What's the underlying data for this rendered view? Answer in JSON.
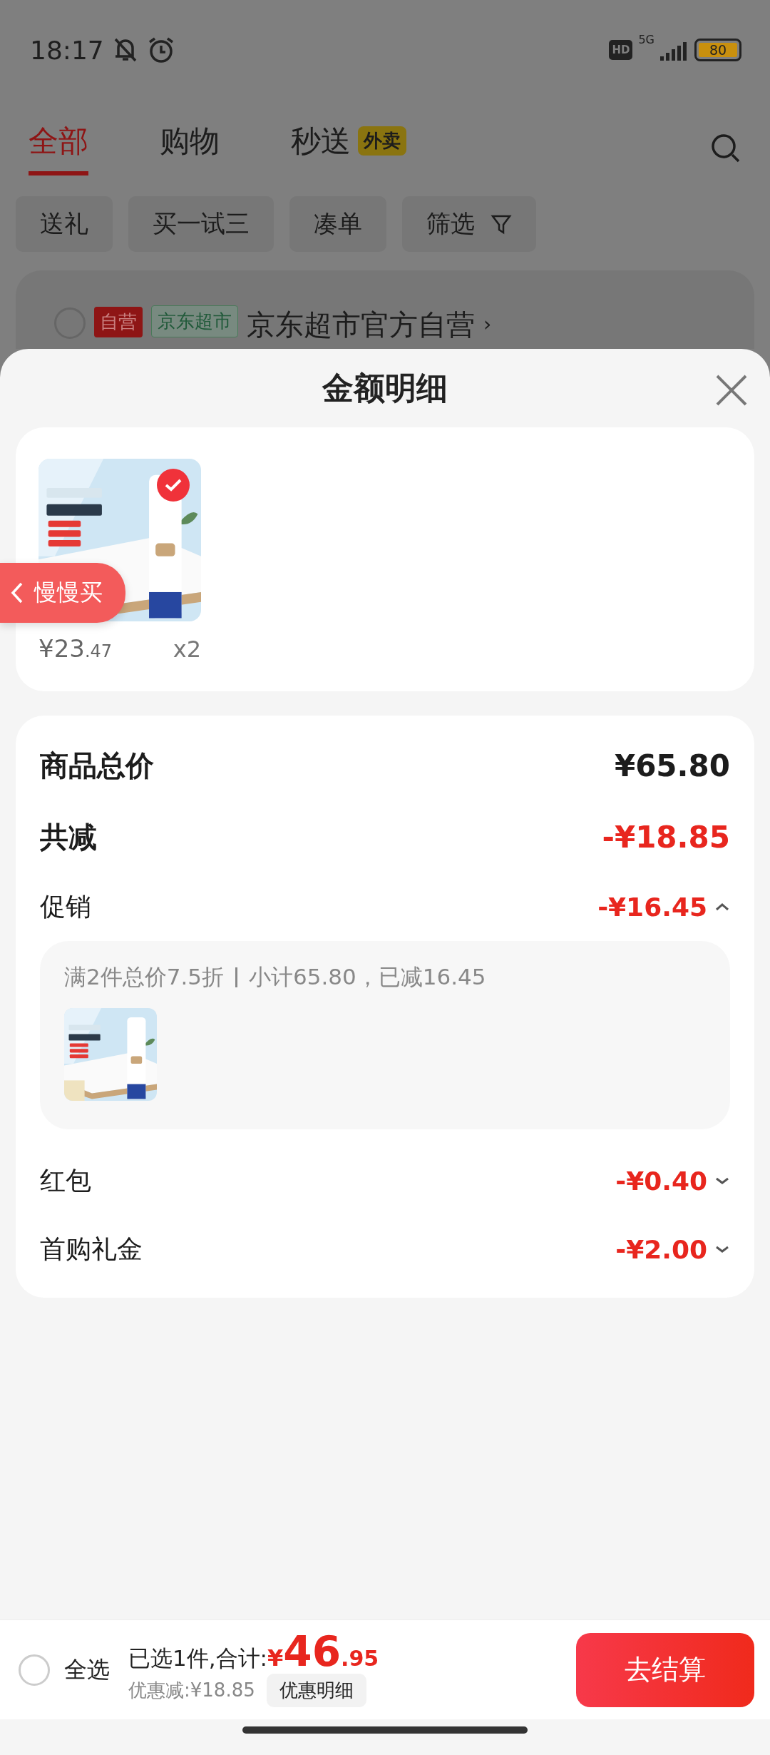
{
  "status_bar": {
    "time": "18:17",
    "hd": "HD",
    "network": "5G",
    "battery": "80"
  },
  "background": {
    "tabs": [
      {
        "label": "全部",
        "selected": true
      },
      {
        "label": "购物",
        "selected": false
      },
      {
        "label": "秒送",
        "selected": false,
        "badge": "外卖"
      }
    ],
    "chips": [
      {
        "label": "送礼",
        "kind": "plain"
      },
      {
        "label": "买一试三",
        "kind": "plain"
      },
      {
        "label": "凑单",
        "kind": "plain"
      },
      {
        "label": "筛选",
        "kind": "filter"
      }
    ],
    "store": {
      "checked": false,
      "tags": [
        {
          "label": "自营",
          "kind": "solid"
        },
        {
          "label": "京东超市",
          "kind": "outline"
        }
      ],
      "name": "京东超市官方自营",
      "arrow": "›"
    }
  },
  "sheet": {
    "title": "金额明细",
    "products": [
      {
        "kind": "picture",
        "selected": true,
        "price_main": "¥23",
        "price_decimal": ".47",
        "quantity": "x2"
      }
    ],
    "floating_button": "慢慢买",
    "rows": [
      {
        "kind": "total",
        "label": "商品总价",
        "amount": "¥65.80"
      },
      {
        "kind": "reduction",
        "label": "共减",
        "amount": "-¥18.85"
      },
      {
        "kind": "discount",
        "label": "促销",
        "amount": "-¥16.45",
        "expanded": true,
        "detail": {
          "rule": "满2件总价7.5折",
          "summary": "小计65.80，已减16.45"
        }
      },
      {
        "kind": "discount",
        "label": "红包",
        "amount": "-¥0.40",
        "expanded": false
      },
      {
        "kind": "discount",
        "label": "首购礼金",
        "amount": "-¥2.00",
        "expanded": false
      }
    ]
  },
  "bottom_bar": {
    "select_all": {
      "label": "全选",
      "checked": false
    },
    "summary": "已选1件,合计:",
    "currency": "¥",
    "total_main": "46",
    "total_decimal": ".95",
    "saved": "优惠减:¥18.85",
    "detail_button": "优惠明细",
    "checkout": "去结算"
  }
}
